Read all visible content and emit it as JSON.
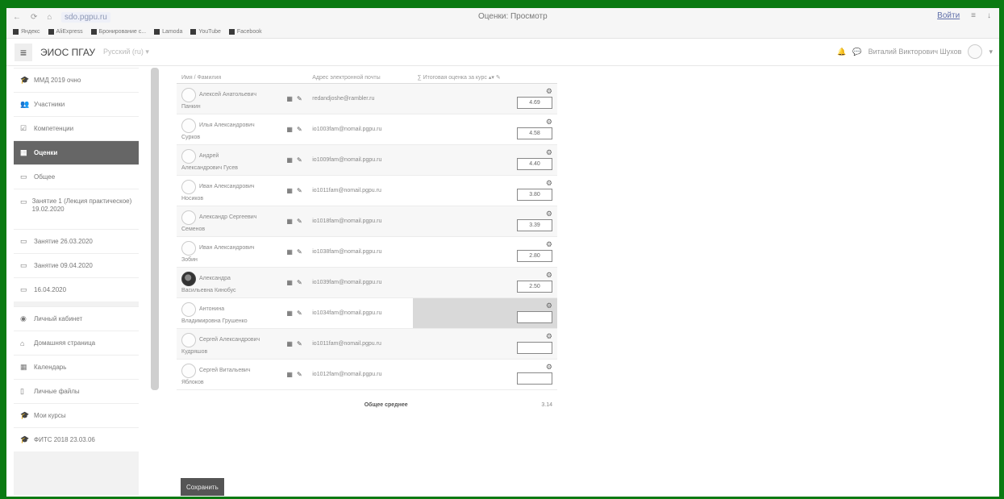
{
  "browser": {
    "url": "sdo.pgpu.ru",
    "window_title": "Оценки: Просмотр",
    "login_label": "Войти",
    "bookmarks": [
      "Яндекс",
      "AliExpress",
      "Бронирование с...",
      "Lamoda",
      "YouTube",
      "Facebook"
    ]
  },
  "header": {
    "brand": "ЭИОС ПГАУ",
    "language": "Русский (ru) ▾",
    "user_name": "Виталий Викторович Шухов"
  },
  "drawer": {
    "groups": [
      [
        {
          "icon": "graduation-cap-icon",
          "glyph": "🎓",
          "label": "ММД 2019 очно",
          "active": false
        },
        {
          "icon": "users-icon",
          "glyph": "👥",
          "label": "Участники",
          "active": false
        },
        {
          "icon": "badge-icon",
          "glyph": "☑",
          "label": "Компетенции",
          "active": false
        },
        {
          "icon": "table-icon",
          "glyph": "▦",
          "label": "Оценки",
          "active": true
        },
        {
          "icon": "folder-icon",
          "glyph": "▭",
          "label": "Общее",
          "active": false
        },
        {
          "icon": "folder-icon",
          "glyph": "▭",
          "label": "Занятие 1 (Лекция практическое) 19.02.2020",
          "active": false,
          "tall": true
        },
        {
          "icon": "folder-icon",
          "glyph": "▭",
          "label": "Занятие 26.03.2020",
          "active": false
        },
        {
          "icon": "folder-icon",
          "glyph": "▭",
          "label": "Занятие 09.04.2020",
          "active": false
        },
        {
          "icon": "folder-icon",
          "glyph": "▭",
          "label": "16.04.2020",
          "active": false
        }
      ],
      [
        {
          "icon": "dashboard-icon",
          "glyph": "◉",
          "label": "Личный кабинет",
          "active": false
        },
        {
          "icon": "home-icon",
          "glyph": "⌂",
          "label": "Домашняя страница",
          "active": false
        },
        {
          "icon": "calendar-icon",
          "glyph": "▦",
          "label": "Календарь",
          "active": false
        },
        {
          "icon": "file-icon",
          "glyph": "▯",
          "label": "Личные файлы",
          "active": false
        },
        {
          "icon": "graduation-cap-icon",
          "glyph": "🎓",
          "label": "Мои курсы",
          "active": false
        },
        {
          "icon": "graduation-cap-icon",
          "glyph": "🎓",
          "label": "ФИТС 2018 23.03.06",
          "active": false
        }
      ]
    ]
  },
  "table": {
    "headers": {
      "name": "Имя / Фамилия",
      "email": "Адрес электронной почты",
      "grade": "Итоговая оценка за курс"
    },
    "rows": [
      {
        "first": "Алексей Анатольевич",
        "last": "Панкин",
        "email": "redandjoshe@rambler.ru",
        "grade": "4.69",
        "photo": false,
        "highlight": false
      },
      {
        "first": "Илья Александрович",
        "last": "Сурков",
        "email": "io1003fam@nomail.pgpu.ru",
        "grade": "4.58",
        "photo": false,
        "highlight": false
      },
      {
        "first": "Андрей",
        "last": "Александрович Гусев",
        "email": "io1009fam@nomail.pgpu.ru",
        "grade": "4.40",
        "photo": false,
        "highlight": false
      },
      {
        "first": "Иван Александрович",
        "last": "Носиков",
        "email": "io1011fam@nomail.pgpu.ru",
        "grade": "3.80",
        "photo": false,
        "highlight": false
      },
      {
        "first": "Александр Сергеевич",
        "last": "Семенов",
        "email": "io1018fam@nomail.pgpu.ru",
        "grade": "3.39",
        "photo": false,
        "highlight": false
      },
      {
        "first": "Иван Александрович",
        "last": "Зобин",
        "email": "io1038fam@nomail.pgpu.ru",
        "grade": "2.80",
        "photo": false,
        "highlight": false
      },
      {
        "first": "Александра",
        "last": "Васильевна Кинобус",
        "email": "io1039fam@nomail.pgpu.ru",
        "grade": "2.50",
        "photo": true,
        "highlight": false
      },
      {
        "first": "Антонина",
        "last": "Владимировна Грушенко",
        "email": "io1034fam@nomail.pgpu.ru",
        "grade": "",
        "photo": false,
        "highlight": true
      },
      {
        "first": "Сергей Александрович",
        "last": "Кудряшов",
        "email": "io1011fam@nomail.pgpu.ru",
        "grade": "",
        "photo": false,
        "highlight": false
      },
      {
        "first": "Сергей Витальевич",
        "last": "Яблоков",
        "email": "io1012fam@nomail.pgpu.ru",
        "grade": "",
        "photo": false,
        "highlight": false
      }
    ],
    "footer_label": "Общее среднее",
    "footer_value": "3.14"
  },
  "actions": {
    "save_label": "Сохранить"
  }
}
